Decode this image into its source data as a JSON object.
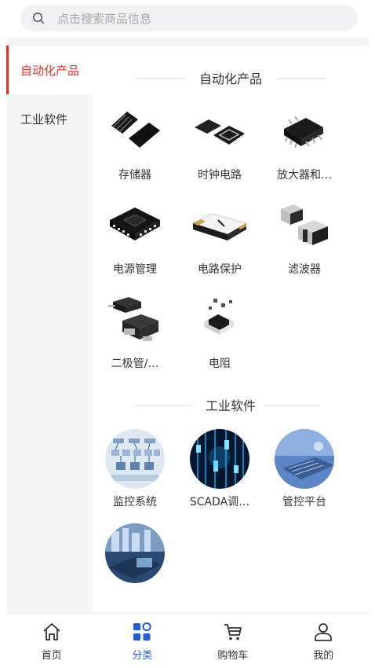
{
  "search": {
    "placeholder": "点击搜索商品信息",
    "icon": "search-icon"
  },
  "sidebar": {
    "items": [
      {
        "label": "自动化产品",
        "active": true
      },
      {
        "label": "工业软件",
        "active": false
      }
    ],
    "accent_color": "#e0322b"
  },
  "sections": [
    {
      "title": "自动化产品",
      "items": [
        {
          "label": "存储器",
          "icon": "memory-chip-image"
        },
        {
          "label": "时钟电路",
          "icon": "clock-circuit-chip-image"
        },
        {
          "label": "放大器和…",
          "icon": "amplifier-chip-image"
        },
        {
          "label": "电源管理",
          "icon": "power-management-chip-image"
        },
        {
          "label": "电路保护",
          "icon": "circuit-protection-image"
        },
        {
          "label": "滤波器",
          "icon": "filter-component-image"
        },
        {
          "label": "二极管/…",
          "icon": "diode-image"
        },
        {
          "label": "电阻",
          "icon": "resistor-image"
        }
      ]
    },
    {
      "title": "工业软件",
      "items": [
        {
          "label": "监控系统",
          "icon": "monitoring-diagram-image"
        },
        {
          "label": "SCADA调…",
          "icon": "scada-data-image"
        },
        {
          "label": "管控平台",
          "icon": "control-platform-image"
        },
        {
          "label": "",
          "icon": "factory-software-image"
        }
      ]
    }
  ],
  "tabbar": {
    "items": [
      {
        "label": "首页",
        "icon": "home-icon",
        "active": false
      },
      {
        "label": "分类",
        "icon": "category-icon",
        "active": true
      },
      {
        "label": "购物车",
        "icon": "cart-icon",
        "active": false
      },
      {
        "label": "我的",
        "icon": "user-icon",
        "active": false
      }
    ],
    "active_color": "#1e5fd6"
  }
}
